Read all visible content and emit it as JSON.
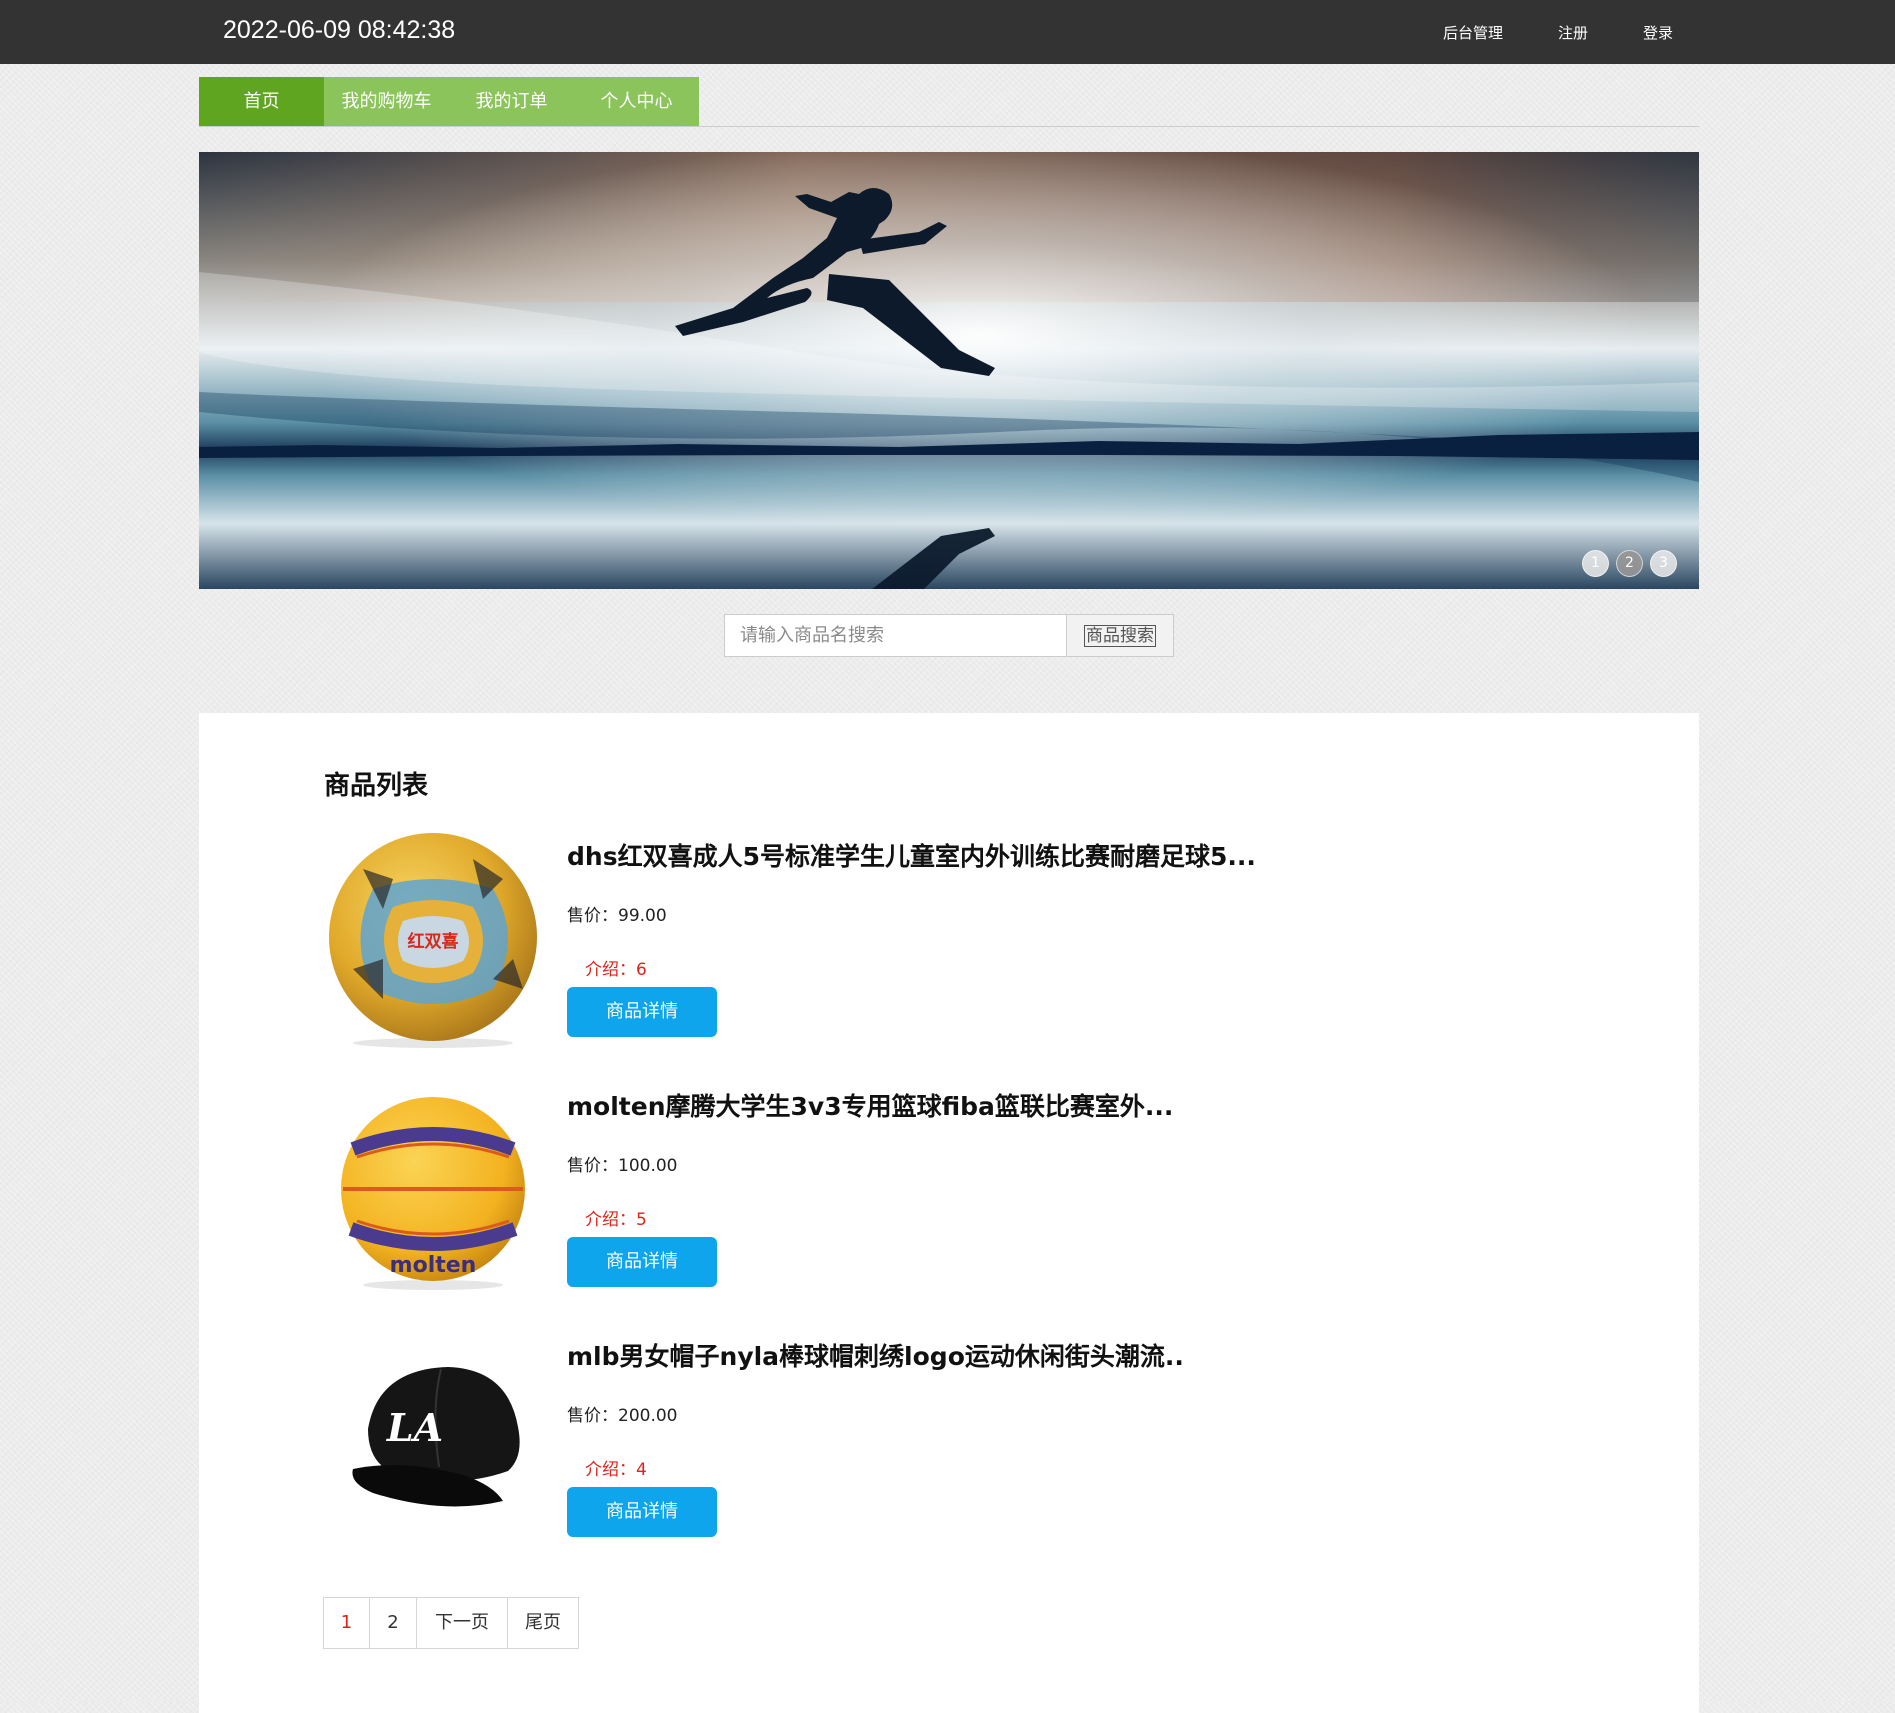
{
  "header": {
    "clock": "2022-06-09 08:42:38",
    "links": [
      "后台管理",
      "注册",
      "登录"
    ]
  },
  "nav": {
    "items": [
      "首页",
      "我的购物车",
      "我的订单",
      "个人中心"
    ]
  },
  "carousel": {
    "dots": [
      "1",
      "2",
      "3"
    ],
    "active_index": 1
  },
  "search": {
    "placeholder": "请输入商品名搜索",
    "value": "",
    "button_label": "商品搜索"
  },
  "products_section": {
    "title": "商品列表",
    "items": [
      {
        "name": "dhs红双喜成人5号标准学生儿童室内外训练比赛耐磨足球5...",
        "price_label": "售价：99.00",
        "intro_label": "介绍：6",
        "button_label": "商品详情",
        "image_icon": "soccer-ball-image",
        "brand_mark": "红双喜"
      },
      {
        "name": "molten摩腾大学生3v3专用篮球fiba篮联比赛室外...",
        "price_label": "售价：100.00",
        "intro_label": "介绍：5",
        "button_label": "商品详情",
        "image_icon": "basketball-image",
        "brand_mark": "molten"
      },
      {
        "name": "mlb男女帽子nyla棒球帽刺绣logo运动休闲街头潮流..",
        "price_label": "售价：200.00",
        "intro_label": "介绍：4",
        "button_label": "商品详情",
        "image_icon": "baseball-cap-image",
        "brand_mark": "LA"
      }
    ]
  },
  "pagination": {
    "items": [
      "1",
      "2",
      "下一页",
      "尾页"
    ],
    "current": "1"
  },
  "colors": {
    "topbar": "#333333",
    "nav_active": "#5fa51f",
    "nav": "#8bc45b",
    "detail_button": "#0ea5ec",
    "intro_text": "#e0221c"
  }
}
